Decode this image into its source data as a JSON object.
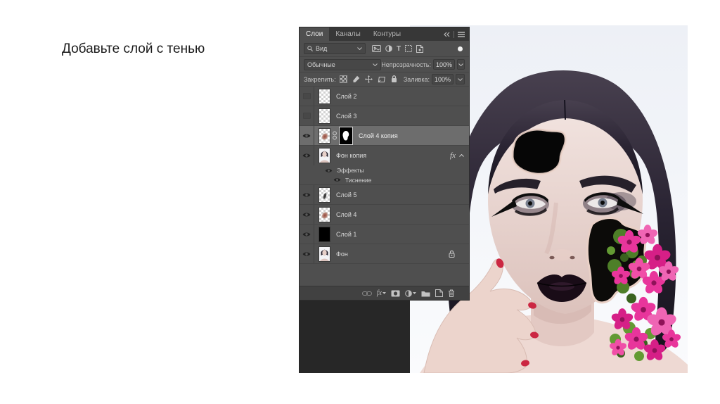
{
  "slide": {
    "title": "Добавьте слой с тенью",
    "background": "#ffffff"
  },
  "ps": {
    "panel": {
      "tabs": [
        {
          "label": "Слои",
          "active": true
        },
        {
          "label": "Каналы",
          "active": false
        },
        {
          "label": "Контуры",
          "active": false
        }
      ],
      "header_icons": [
        "collapse-panels-icon",
        "panel-menu-icon"
      ],
      "filter": {
        "search_label": "Вид",
        "filter_icons": [
          "pixel-layers-filter-icon",
          "adjustment-layers-filter-icon",
          "type-layers-filter-icon",
          "shape-layers-filter-icon",
          "smart-object-filter-icon"
        ],
        "toggle_icon": "layer-filtering-toggle",
        "toggle_on": true
      },
      "blend": {
        "mode": "Обычные",
        "opacity_label": "Непрозрачность:",
        "opacity_value": "100%"
      },
      "lock": {
        "label": "Закрепить:",
        "lock_icons": [
          "lock-transparency-icon",
          "lock-pixels-icon",
          "lock-position-icon",
          "lock-artboard-icon",
          "lock-all-icon"
        ],
        "fill_label": "Заливка:",
        "fill_value": "100%"
      },
      "layers": [
        {
          "name": "Слой 2",
          "visible": false,
          "thumb": "checker"
        },
        {
          "name": "Слой 3",
          "visible": false,
          "thumb": "checker"
        },
        {
          "name": "Слой 4 копия",
          "visible": true,
          "selected": true,
          "thumb": "checker-smudge",
          "has_mask": true
        },
        {
          "name": "Фон копия",
          "visible": true,
          "thumb": "portrait",
          "has_fx": true,
          "fx_label": "fx"
        },
        {
          "name": "Эффекты",
          "visible": true,
          "row_type": "effects-group"
        },
        {
          "name": "Тиснение",
          "visible": true,
          "row_type": "effect"
        },
        {
          "name": "Слой 5",
          "visible": true,
          "thumb": "checker-mark"
        },
        {
          "name": "Слой 4",
          "visible": true,
          "thumb": "checker-smudge"
        },
        {
          "name": "Слой 1",
          "visible": true,
          "thumb": "black"
        },
        {
          "name": "Фон",
          "visible": true,
          "thumb": "portrait",
          "locked": true
        }
      ],
      "bottom_icons": [
        "link-layers-icon",
        "layer-style-icon",
        "add-layer-mask-icon",
        "new-adjustment-layer-icon",
        "new-group-icon",
        "new-layer-icon",
        "delete-layer-icon"
      ]
    },
    "colors": {
      "panel_bg": "#4f4f4f",
      "tabbar_bg": "#373737",
      "selected_row": "#6d6d6d",
      "pasteboard": "#272727",
      "panel_text": "#d6d6d6",
      "flower_pink": "#e8359b",
      "foliage_green": "#5c8f33"
    }
  }
}
